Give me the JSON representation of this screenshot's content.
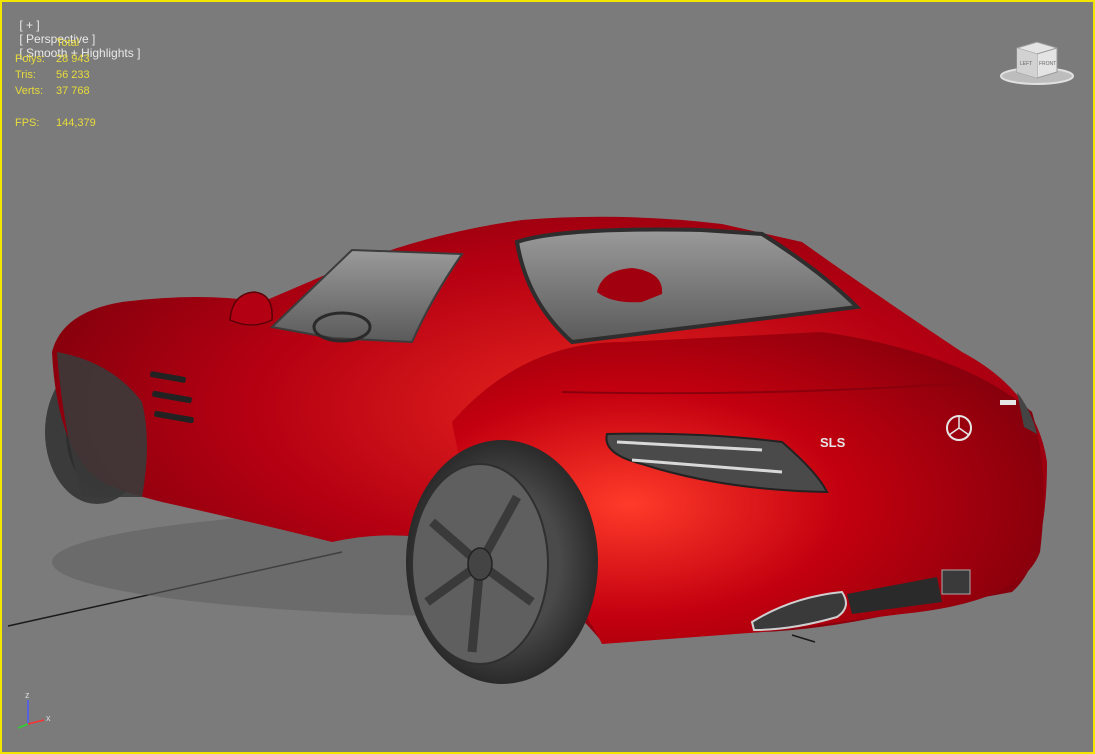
{
  "viewport": {
    "label_parts": [
      "[ + ]",
      "[ Perspective ]",
      "[ Smooth + Highlights ]"
    ],
    "border_color": "#f2e600",
    "background": "#7b7b7b"
  },
  "stats": {
    "header": "Total",
    "rows": [
      {
        "label": "Polys:",
        "value": "28 943"
      },
      {
        "label": "Tris:",
        "value": "56 233"
      },
      {
        "label": "Verts:",
        "value": "37 768"
      }
    ],
    "fps_label": "FPS:",
    "fps_value": "144,379",
    "color": "#e8dc3a"
  },
  "viewcube": {
    "faces": [
      "LEFT",
      "FRONT"
    ]
  },
  "axis_tripod": {
    "labels": [
      "z",
      "x"
    ]
  },
  "car": {
    "badge": "SLS",
    "body_color": "#c00012"
  }
}
